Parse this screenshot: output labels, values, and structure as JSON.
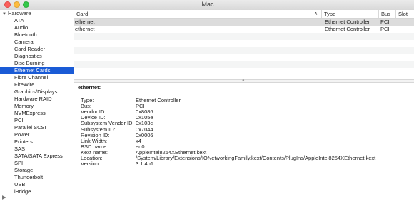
{
  "window": {
    "title": "iMac"
  },
  "sidebar": {
    "group": "Hardware",
    "items": [
      "ATA",
      "Audio",
      "Bluetooth",
      "Camera",
      "Card Reader",
      "Diagnostics",
      "Disc Burning",
      "Ethernet Cards",
      "Fibre Channel",
      "FireWire",
      "Graphics/Displays",
      "Hardware RAID",
      "Memory",
      "NVMExpress",
      "PCI",
      "Parallel SCSI",
      "Power",
      "Printers",
      "SAS",
      "SATA/SATA Express",
      "SPI",
      "Storage",
      "Thunderbolt",
      "USB",
      "iBridge"
    ],
    "selected": "Ethernet Cards"
  },
  "table": {
    "columns": {
      "card": "Card",
      "type": "Type",
      "bus": "Bus",
      "slot": "Slot"
    },
    "rows": [
      {
        "card": "ethernet",
        "type": "Ethernet Controller",
        "bus": "PCI",
        "slot": ""
      },
      {
        "card": "ethernet",
        "type": "Ethernet Controller",
        "bus": "PCI",
        "slot": ""
      }
    ]
  },
  "detail": {
    "title": "ethernet:",
    "properties": [
      {
        "label": "Type:",
        "value": "Ethernet Controller"
      },
      {
        "label": "Bus:",
        "value": "PCI"
      },
      {
        "label": "Vendor ID:",
        "value": "0x8086"
      },
      {
        "label": "Device ID:",
        "value": "0x105e"
      },
      {
        "label": "Subsystem Vendor ID:",
        "value": "0x103c"
      },
      {
        "label": "Subsystem ID:",
        "value": "0x7044"
      },
      {
        "label": "Revision ID:",
        "value": "0x0006"
      },
      {
        "label": "Link Width:",
        "value": "x4"
      },
      {
        "label": "BSD name:",
        "value": "en0"
      },
      {
        "label": "Kext name:",
        "value": "AppleIntel8254XEthernet.kext"
      },
      {
        "label": "Location:",
        "value": "/System/Library/Extensions/IONetworkingFamily.kext/Contents/PlugIns/AppleIntel8254XEthernet.kext"
      },
      {
        "label": "Version:",
        "value": "3.1.4b1"
      }
    ]
  },
  "colors": {
    "selection": "#1a5bd6",
    "row_selected": "#dcdcdc"
  }
}
